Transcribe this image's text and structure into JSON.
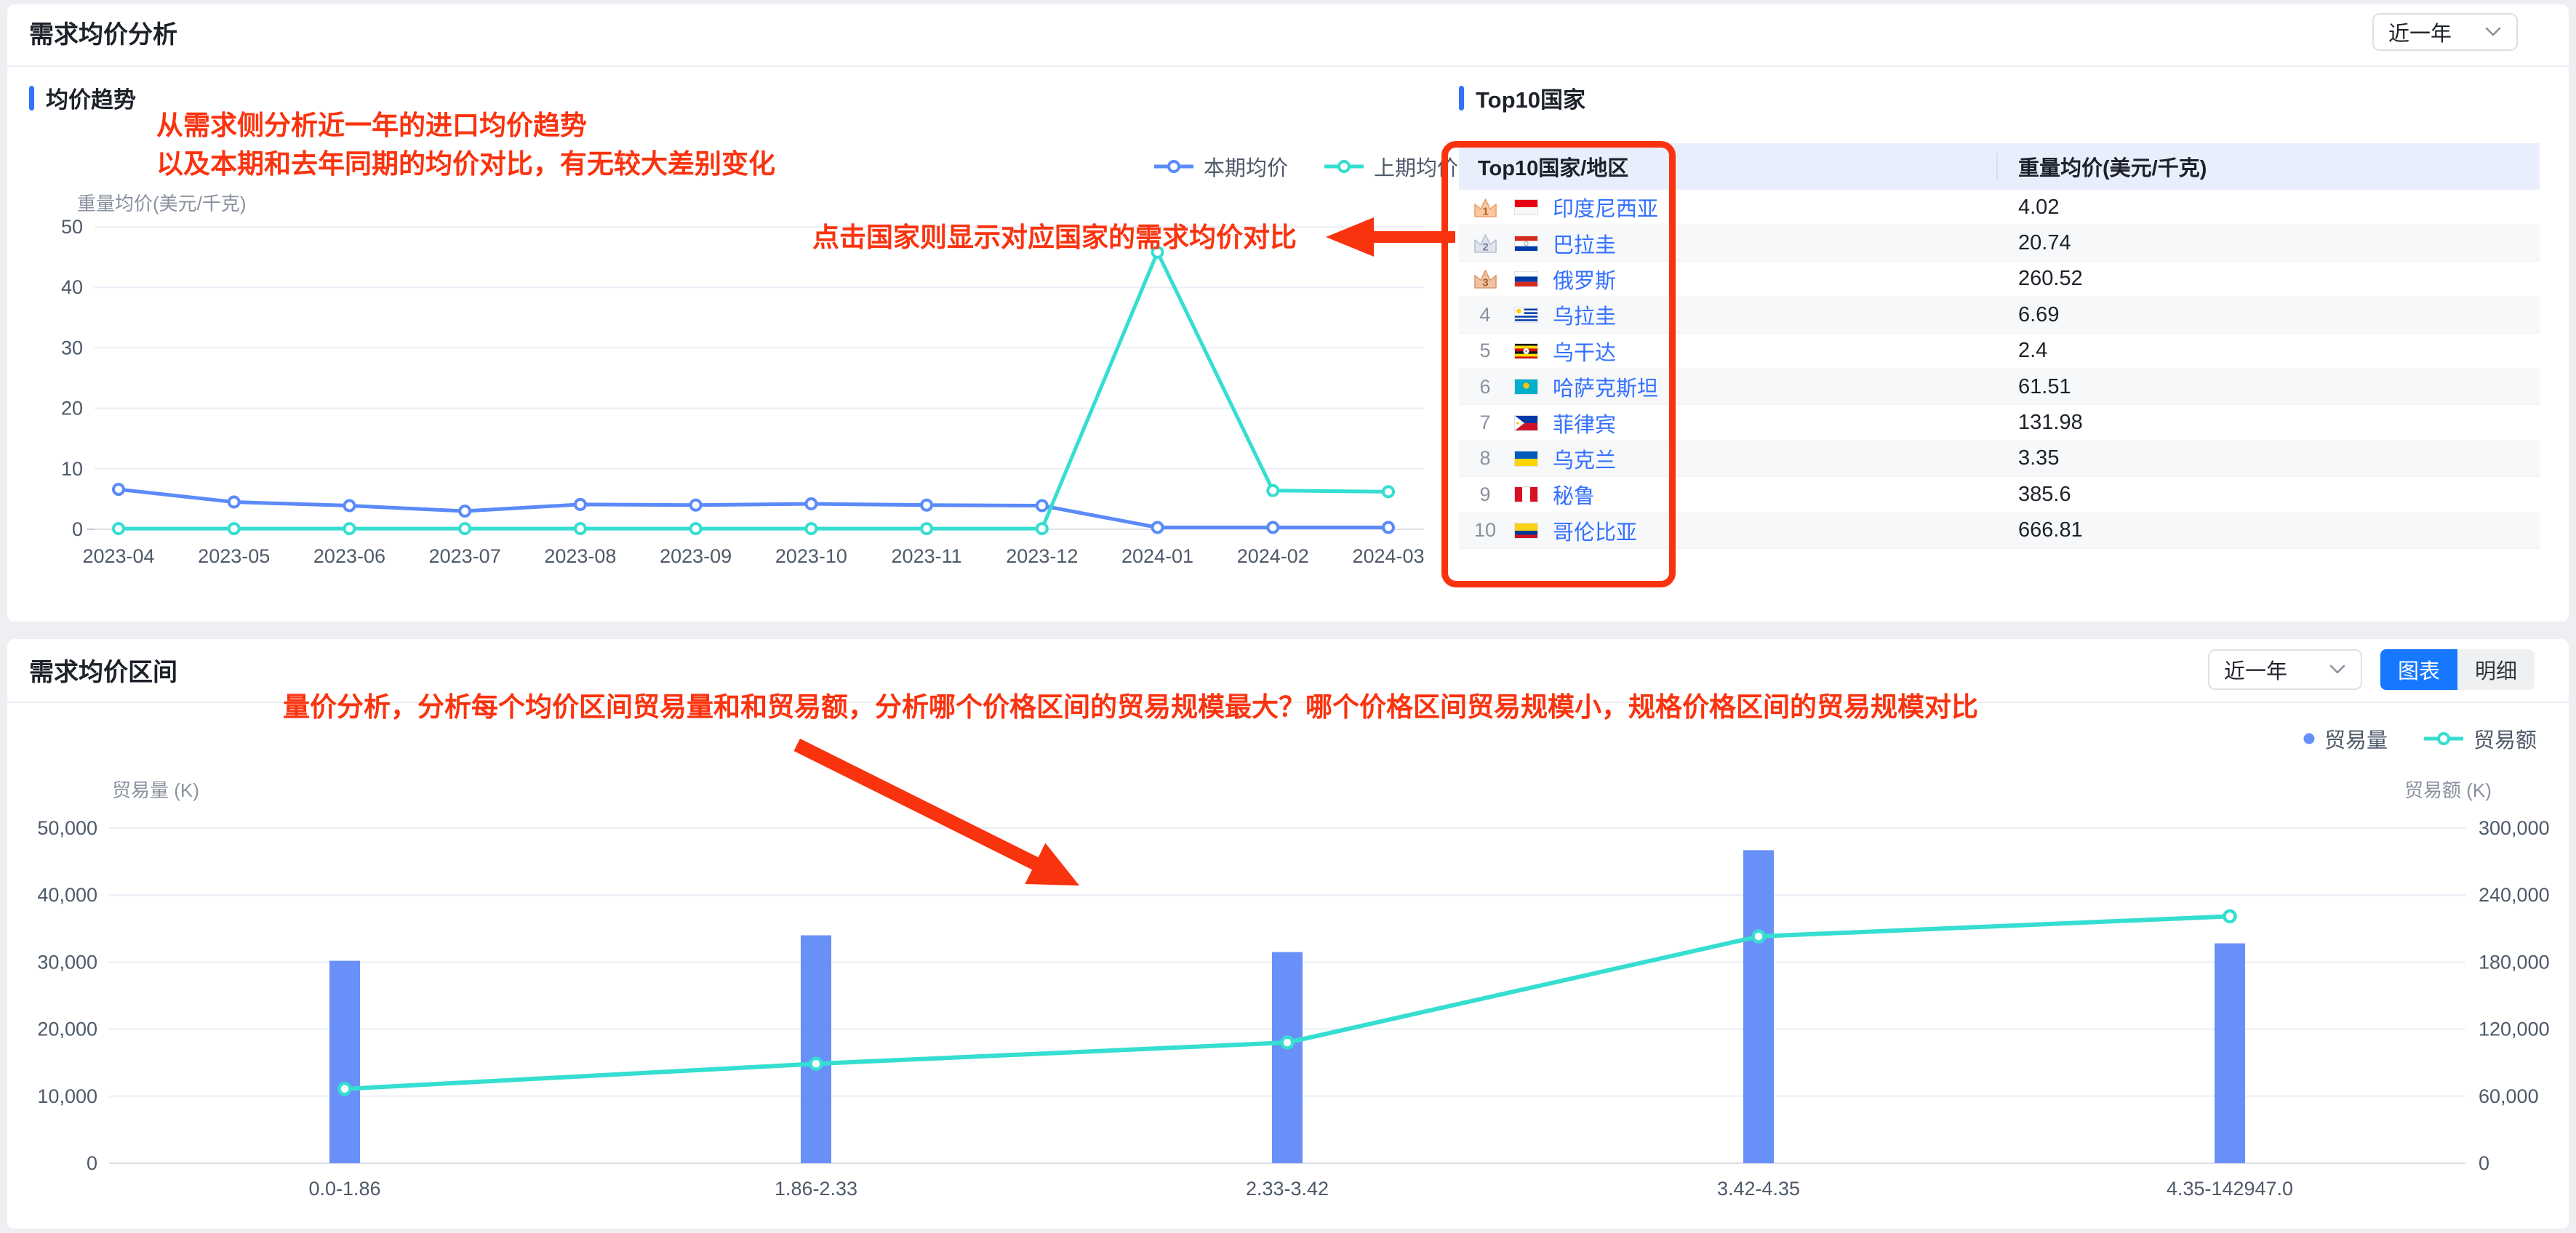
{
  "colors": {
    "annotation_red": "#fa330f",
    "accent_blue": "#3370ff",
    "tab_active_blue": "#1677ff",
    "link_blue": "#3370ff",
    "bar_blue": "#6990f8",
    "line_blue": "#5b8af9",
    "line_cyan": "#35ded0",
    "table_header_bg": "#e9eefc"
  },
  "header": {
    "title": "需求均价分析",
    "range_value": "近一年"
  },
  "trend_panel": {
    "section_title": "均价趋势",
    "y_axis_title": "重量均价(美元/千克)",
    "annotations": {
      "line1": "从需求侧分析近一年的进口均价趋势",
      "line2": "以及本期和去年同期的均价对比，有无较大差别变化",
      "click_tip": "点击国家则显示对应国家的需求均价对比"
    }
  },
  "top10_panel": {
    "section_title": "Top10国家",
    "columns": [
      "Top10国家/地区",
      "重量均价(美元/千克)"
    ],
    "rows": [
      {
        "rank": 1,
        "country": "印度尼西亚",
        "flag": "id",
        "value": "4.02"
      },
      {
        "rank": 2,
        "country": "巴拉圭",
        "flag": "py",
        "value": "20.74"
      },
      {
        "rank": 3,
        "country": "俄罗斯",
        "flag": "ru",
        "value": "260.52"
      },
      {
        "rank": 4,
        "country": "乌拉圭",
        "flag": "uy",
        "value": "6.69"
      },
      {
        "rank": 5,
        "country": "乌干达",
        "flag": "ug",
        "value": "2.4"
      },
      {
        "rank": 6,
        "country": "哈萨克斯坦",
        "flag": "kz",
        "value": "61.51"
      },
      {
        "rank": 7,
        "country": "菲律宾",
        "flag": "ph",
        "value": "131.98"
      },
      {
        "rank": 8,
        "country": "乌克兰",
        "flag": "ua",
        "value": "3.35"
      },
      {
        "rank": 9,
        "country": "秘鲁",
        "flag": "pe",
        "value": "385.6"
      },
      {
        "rank": 10,
        "country": "哥伦比亚",
        "flag": "co",
        "value": "666.81"
      }
    ]
  },
  "range_panel": {
    "title": "需求均价区间",
    "range_value": "近一年",
    "tabs": [
      {
        "label": "图表",
        "active": true
      },
      {
        "label": "明细",
        "active": false
      }
    ],
    "annotation": "量价分析，分析每个均价区间贸易量和和贸易额，分析哪个价格区间的贸易规模最大？哪个价格区间贸易规模小，规格价格区间的贸易规模对比",
    "y_left_title": "贸易量 (K)",
    "y_right_title": "贸易额 (K)"
  },
  "chart_data": [
    {
      "type": "line",
      "title": "均价趋势",
      "ylabel": "重量均价(美元/千克)",
      "categories": [
        "2023-04",
        "2023-05",
        "2023-06",
        "2023-07",
        "2023-08",
        "2023-09",
        "2023-10",
        "2023-11",
        "2023-12",
        "2024-01",
        "2024-02",
        "2024-03"
      ],
      "series": [
        {
          "name": "本期均价",
          "color": "#5b8af9",
          "values": [
            6.6,
            4.5,
            3.9,
            3.0,
            4.1,
            4.0,
            4.2,
            4.0,
            3.9,
            0.3,
            0.3,
            0.3
          ]
        },
        {
          "name": "上期均价",
          "color": "#35ded0",
          "values": [
            0.1,
            0.1,
            0.1,
            0.1,
            0.1,
            0.1,
            0.1,
            0.1,
            0.1,
            45.8,
            6.4,
            6.2
          ]
        }
      ],
      "ylim": [
        0,
        50
      ],
      "yticks": [
        0,
        10,
        20,
        30,
        40,
        50
      ],
      "grid": true,
      "legend_position": "top-right"
    },
    {
      "type": "bar-line",
      "title": "需求均价区间",
      "categories": [
        "0.0-1.86",
        "1.86-2.33",
        "2.33-3.42",
        "3.42-4.35",
        "4.35-142947.0"
      ],
      "bar_series": {
        "name": "贸易量",
        "color": "#6990f8",
        "axis": "left",
        "values": [
          30200,
          34000,
          31500,
          46700,
          32800
        ]
      },
      "line_series": {
        "name": "贸易额",
        "color": "#35ded0",
        "axis": "right",
        "values": [
          66500,
          89000,
          108000,
          203000,
          221000
        ]
      },
      "ylabel_left": "贸易量 (K)",
      "ylabel_right": "贸易额 (K)",
      "ylim_left": [
        0,
        50000
      ],
      "yticks_left": [
        0,
        10000,
        20000,
        30000,
        40000,
        50000
      ],
      "ylim_right": [
        0,
        300000
      ],
      "yticks_right": [
        0,
        60000,
        120000,
        180000,
        240000,
        300000
      ],
      "grid": true,
      "legend_position": "top-right"
    }
  ]
}
